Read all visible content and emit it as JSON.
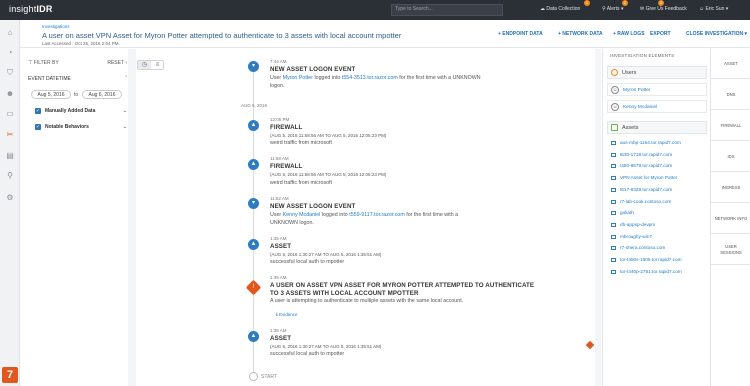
{
  "topbar": {
    "logo_prefix": "insight",
    "logo_suffix": "IDR",
    "search_placeholder": "Type to Search...",
    "items": [
      {
        "label": "Data Collection",
        "badge": "1"
      },
      {
        "label": "Alerts",
        "badge": "2"
      },
      {
        "label": "Give Us Feedback",
        "badge": "3"
      },
      {
        "label": "Eric Sun"
      }
    ]
  },
  "header": {
    "breadcrumb": "Investigations",
    "title": "A user on asset VPN Asset for Myron Potter attempted to authenticate to 3 assets with local account mpotter",
    "accessed": "Last Accessed : Oct 26, 2016 2:04 PM",
    "actions": [
      "+ ENDPOINT DATA",
      "+ NETWORK DATA",
      "+ RAW LOGS",
      "EXPORT",
      "CLOSE INVESTIGATION"
    ]
  },
  "filters": {
    "title": "FILTER BY",
    "reset": "RESET",
    "event_datetime": "EVENT DATETIME",
    "from": "Aug 5, 2016",
    "to_label": "to",
    "to": "Aug 6, 2016",
    "options": [
      {
        "label": "Manually Added Data",
        "checked": true
      },
      {
        "label": "Notable Behaviors",
        "checked": true
      }
    ]
  },
  "timeline": {
    "date_separator": "AUG 5, 2016",
    "start": "START",
    "events": [
      {
        "time": "7:44 AM",
        "title": "NEW ASSET LOGON EVENT",
        "desc_prefix": "User ",
        "user": "Myron Potter",
        "desc_mid": " logged into ",
        "asset": "t554-3513.tor.razor.com",
        "desc_suffix": " for the first time with a UNKNOWN",
        "desc2": "logon."
      },
      {
        "time": "12:05 PM",
        "title": "FIREWALL",
        "sub": "(AUG 5, 2016 11:58:56 AM TO AUG 5, 2016 12:05:23 PM)",
        "desc": "weird traffic from microsoft"
      },
      {
        "time": "11:58 AM",
        "title": "FIREWALL",
        "sub": "(AUG 5, 2016 11:58:56 AM TO AUG 5, 2016 12:05:23 PM)",
        "desc": "weird traffic from microsoft"
      },
      {
        "time": "11:52 AM",
        "title": "NEW ASSET LOGON EVENT",
        "desc_prefix": "User ",
        "user": "Kenny Mcdaniel",
        "desc_mid": " logged into ",
        "asset": "t559-9117.tor.razor.com",
        "desc_suffix": " for the first time with a",
        "desc2": "UNKNOWN logon."
      },
      {
        "time": "1:35 AM",
        "title": "ASSET",
        "sub": "(AUG 5, 2016 1:30:27 AM TO AUG 5, 2016 1:35:51 AM)",
        "desc": "successful local auth to mpotter"
      },
      {
        "time": "1:35 AM",
        "title": "A USER ON ASSET VPN ASSET FOR MYRON POTTER ATTEMPTED TO AUTHENTICATE",
        "title2": "TO 3 ASSETS WITH LOCAL ACCOUNT MPOTTER",
        "desc": "A user is attempting to authenticate to multiple assets with the same local account.",
        "evidence": "Evidence"
      },
      {
        "time": "1:35 AM",
        "title": "ASSET",
        "sub": "(AUG 5, 2016 1:30:27 AM TO AUG 5, 2016 1:35:51 AM)",
        "desc": "successful local auth to mpotter"
      }
    ]
  },
  "investigation": {
    "title": "INVESTIGATION ELEMENTS",
    "users_label": "Users",
    "users": [
      "Myron Potter",
      "Kenny Mcdaniel"
    ],
    "assets_label": "Assets",
    "assets": [
      "aus-mbp-1164.tor.rapid7.com",
      "t630-1718.tor.rapid7.com",
      "t450-8578.tor.rapid7.com",
      "VPN Asset for Myron Potter",
      "t617-8329.tor.rapid7.com",
      "r7-lab-cook.contoso.com",
      "goliath",
      "dh-appsp-devpm",
      "mbroughy-win7",
      "r7-shera.contoso.com",
      "tor-t450s-1605.tor.rapid7.com",
      "tor-t440p-2781.tor.rapid7.com"
    ]
  },
  "right_tabs": [
    "ASSET",
    "DNS",
    "FIREWALL",
    "IDS",
    "INGRESS",
    "NETWORK INFO",
    "USER SESSIONS"
  ]
}
